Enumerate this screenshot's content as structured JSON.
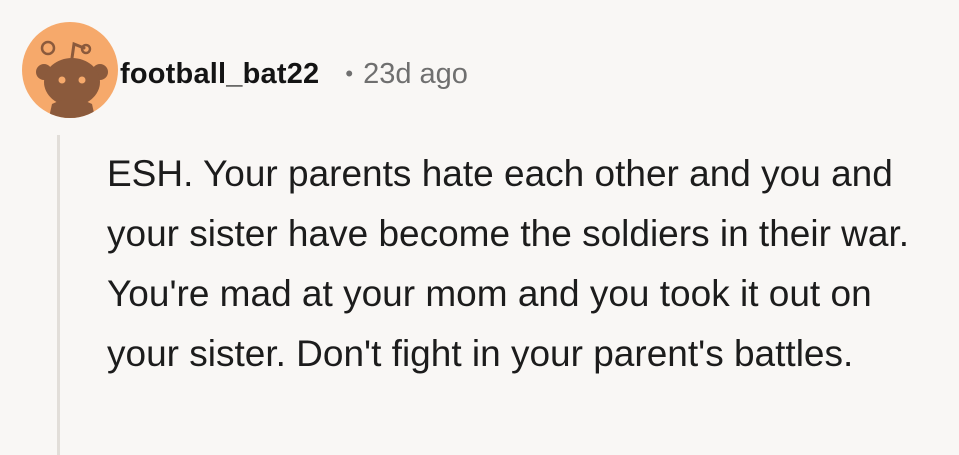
{
  "comment": {
    "author": "football_bat22",
    "separator": "•",
    "timestamp": "23d ago",
    "body": "ESH. Your parents hate each other and you and your sister have become the soldiers in their war. You're mad at your mom and you took it out on your sister. Don't fight in your parent's battles."
  },
  "colors": {
    "avatar_bg": "#f6a96b",
    "avatar_figure": "#8b5a3c",
    "background": "#f9f7f5"
  },
  "icons": {
    "avatar": "snoo-avatar-icon"
  }
}
